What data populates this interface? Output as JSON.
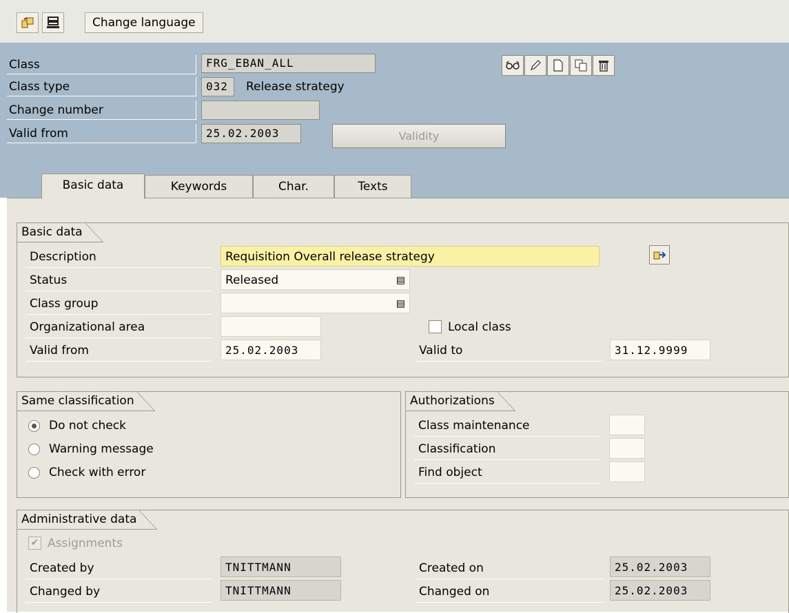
{
  "toolbar": {
    "change_language": "Change language"
  },
  "header": {
    "class_label": "Class",
    "class_value": "FRG_EBAN_ALL",
    "class_type_label": "Class type",
    "class_type_value": "032",
    "class_type_text": "Release strategy",
    "change_number_label": "Change number",
    "change_number_value": "",
    "valid_from_label": "Valid from",
    "valid_from_value": "25.02.2003",
    "validity_button": "Validity"
  },
  "tabs": [
    {
      "label": "Basic data",
      "active": true
    },
    {
      "label": "Keywords",
      "active": false
    },
    {
      "label": "Char.",
      "active": false
    },
    {
      "label": "Texts",
      "active": false
    }
  ],
  "basic_data": {
    "title": "Basic data",
    "description_label": "Description",
    "description_value": "Requisition Overall release strategy",
    "status_label": "Status",
    "status_value": "Released",
    "class_group_label": "Class group",
    "class_group_value": "",
    "org_area_label": "Organizational area",
    "org_area_value": "",
    "local_class_label": "Local class",
    "local_class_checked": false,
    "valid_from_label": "Valid from",
    "valid_from_value": "25.02.2003",
    "valid_to_label": "Valid to",
    "valid_to_value": "31.12.9999"
  },
  "same_classification": {
    "title": "Same classification",
    "options": [
      {
        "label": "Do not check",
        "selected": true
      },
      {
        "label": "Warning message",
        "selected": false
      },
      {
        "label": "Check with error",
        "selected": false
      }
    ]
  },
  "authorizations": {
    "title": "Authorizations",
    "class_maintenance_label": "Class maintenance",
    "classification_label": "Classification",
    "find_object_label": "Find object"
  },
  "admin": {
    "title": "Administrative data",
    "assignments_label": "Assignments",
    "created_by_label": "Created by",
    "created_by_value": "TNITTMANN",
    "changed_by_label": "Changed by",
    "changed_by_value": "TNITTMANN",
    "created_on_label": "Created on",
    "created_on_value": "25.02.2003",
    "changed_on_label": "Changed on",
    "changed_on_value": "25.02.2003"
  },
  "colors": {
    "header_bg": "#a7bac9",
    "panel_bg": "#e8e6dd",
    "required_field": "#fbf1a5"
  }
}
